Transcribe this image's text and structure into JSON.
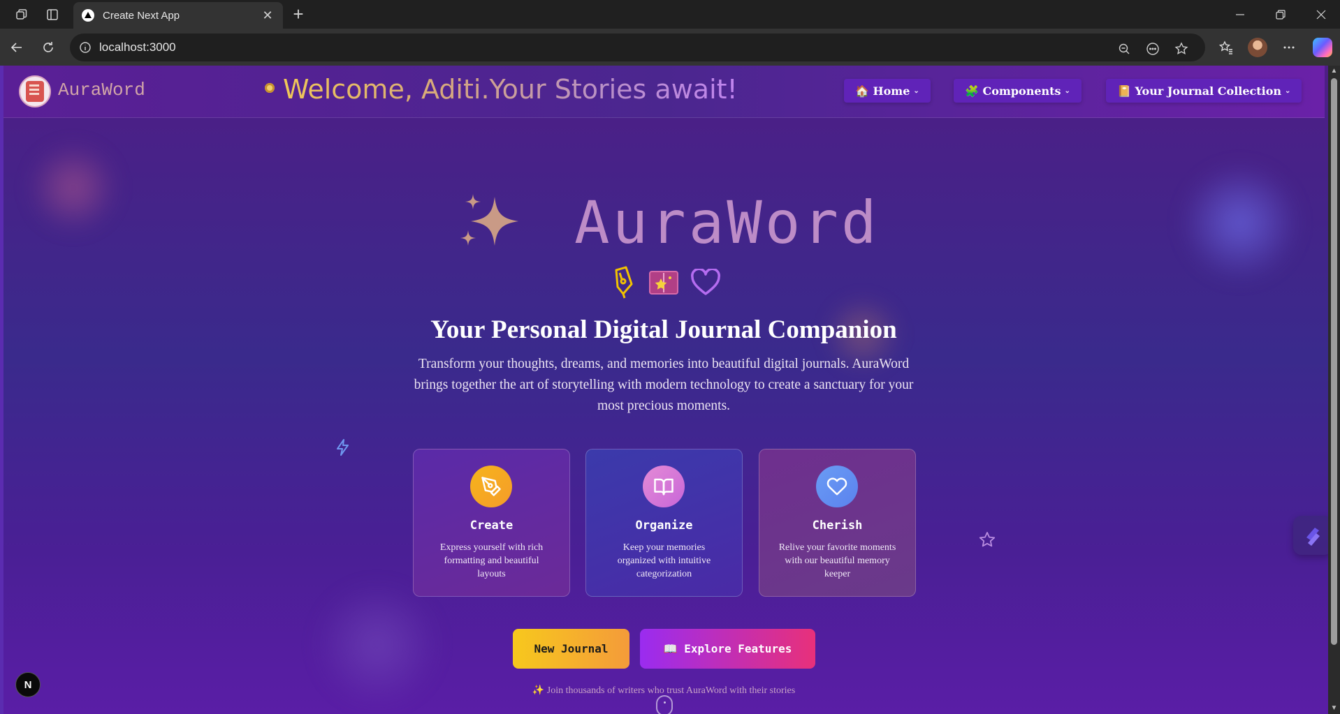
{
  "browser": {
    "tab_title": "Create Next App",
    "url": "localhost:3000"
  },
  "header": {
    "logo_text": "AuraWord",
    "welcome": "Welcome, Aditi.Your Stories await!",
    "nav": [
      {
        "emoji": "🏠",
        "label": "Home"
      },
      {
        "emoji": "🧩",
        "label": "Components"
      },
      {
        "emoji": "📔",
        "label": "Your Journal Collection"
      }
    ]
  },
  "hero": {
    "title": "AuraWord",
    "subtitle": "Your Personal Digital Journal Companion",
    "description": "Transform your thoughts, dreams, and memories into beautiful digital journals. AuraWord brings together the art of storytelling with modern technology to create a sanctuary for your most precious moments."
  },
  "features": [
    {
      "title": "Create",
      "desc": "Express yourself with rich formatting and beautiful layouts",
      "icon": "pen-tool-icon",
      "color": "#f6a820"
    },
    {
      "title": "Organize",
      "desc": "Keep your memories organized with intuitive categorization",
      "icon": "book-open-icon",
      "color": "#d97ad8"
    },
    {
      "title": "Cherish",
      "desc": "Relive your favorite moments with our beautiful memory keeper",
      "icon": "heart-icon",
      "color": "#5f8ff2"
    }
  ],
  "actions": {
    "new_journal": "New Journal",
    "explore": "📖 Explore Features"
  },
  "footer_note": "✨ Join thousands of writers who trust AuraWord with their stories",
  "next_badge": "N",
  "colors": {
    "accent_yellow": "#f7c81d",
    "accent_pink": "#e8307a",
    "accent_purple": "#9a2cf0"
  }
}
